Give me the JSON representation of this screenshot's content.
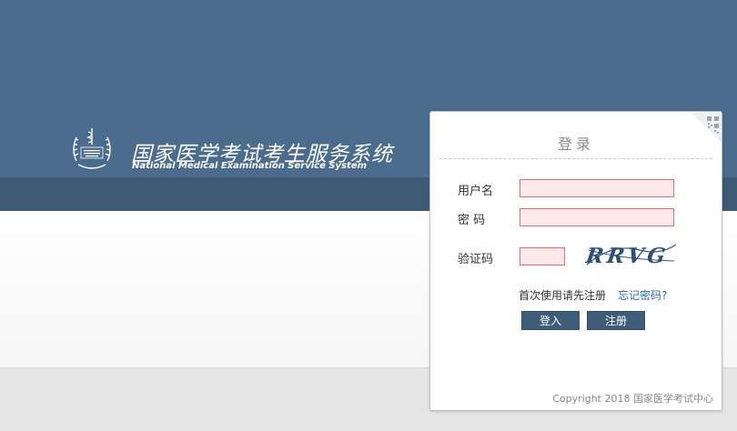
{
  "header": {
    "title_cn": "国家医学考试考生服务系统",
    "title_en": "National Medical Examination Service System",
    "logo_icon": "medical-emblem-icon"
  },
  "login": {
    "title": "登录",
    "username_label": "用户名",
    "password_label": "密 码",
    "captcha_label": "验证码",
    "captcha_text": "RRVG",
    "username_value": "",
    "password_value": "",
    "captcha_value": "",
    "first_time_hint": "首次使用请先注册",
    "forgot_password": "忘记密码?",
    "login_button": "登入",
    "register_button": "注册",
    "copyright": "Copyright 2018 国家医学考试中心",
    "qr_icon": "qr-code-icon"
  },
  "colors": {
    "banner": "#4b6c8c",
    "banner_band": "#3e5a75",
    "button": "#3f5c78",
    "input_bg": "#fde8ea",
    "input_border": "#e26b77",
    "link": "#2e6aa6"
  }
}
